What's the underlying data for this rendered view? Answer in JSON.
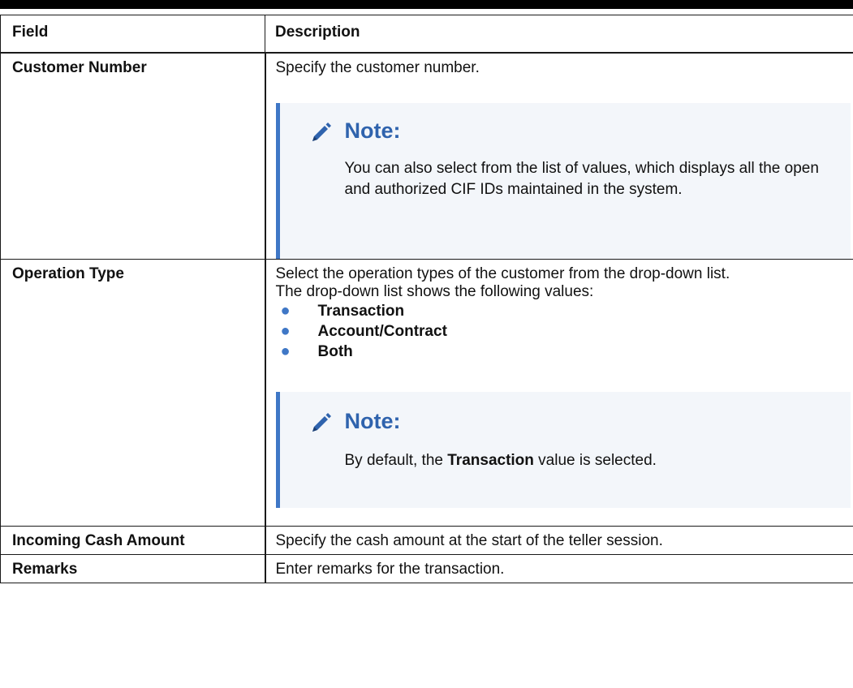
{
  "table": {
    "header": {
      "field": "Field",
      "description": "Description"
    },
    "rows": [
      {
        "field": "Customer Number",
        "description": "Specify the customer number.",
        "note": {
          "title": "Note:",
          "text": "You can also select from the list of values, which displays all the open and authorized CIF IDs maintained in the system."
        }
      },
      {
        "field": "Operation Type",
        "description_line1": "Select the operation types of the customer from the drop-down list.",
        "description_line2": "The drop-down list shows the following values:",
        "values": [
          "Transaction",
          "Account/Contract",
          "Both"
        ],
        "note": {
          "title": "Note:",
          "text_before": "By default, the ",
          "text_bold": "Transaction",
          "text_after": " value is selected."
        }
      },
      {
        "field": "Incoming Cash Amount",
        "description": "Specify the cash amount at the start of the teller session."
      },
      {
        "field": "Remarks",
        "description": "Enter remarks for the transaction."
      }
    ]
  },
  "colors": {
    "note_accent": "#3f77c6",
    "note_title": "#2f63ad",
    "note_bg": "#f3f6fa"
  },
  "icons": {
    "note_icon": "pencil-icon",
    "bullet_icon": "bullet-icon"
  }
}
